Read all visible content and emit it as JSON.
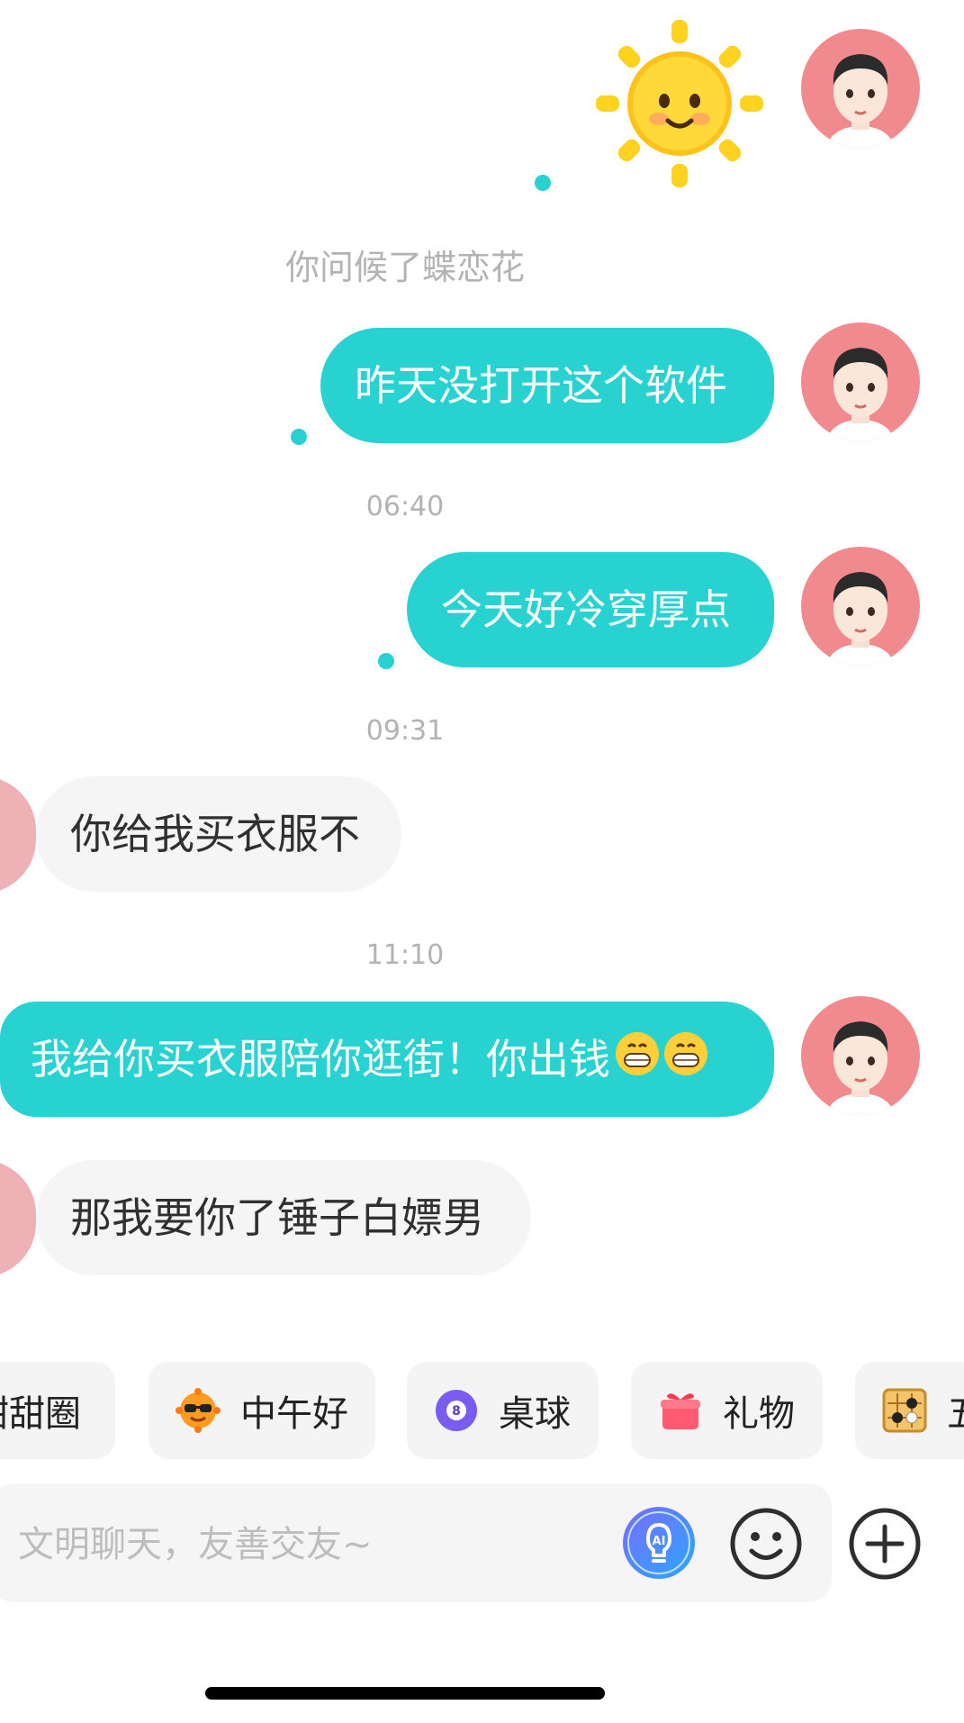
{
  "system_note": "你问候了蝶恋花",
  "messages": [
    {
      "side": "me",
      "text": "昨天没打开这个软件"
    },
    {
      "time": "06:40"
    },
    {
      "side": "me",
      "text": "今天好冷穿厚点"
    },
    {
      "time": "09:31"
    },
    {
      "side": "other",
      "text": "你给我买衣服不"
    },
    {
      "time": "11:10"
    },
    {
      "side": "me",
      "text": "我给你买衣服陪你逛街！你出钱",
      "trailing_emoji": "grinning-face ×2"
    },
    {
      "side": "other",
      "text": "那我要你了锤子白嫖男"
    }
  ],
  "quick_chips": [
    {
      "label": "甜甜圈",
      "icon": "donut-icon"
    },
    {
      "label": "中午好",
      "icon": "sunglasses-sun-icon"
    },
    {
      "label": "桌球",
      "icon": "billiard-ball-icon"
    },
    {
      "label": "礼物",
      "icon": "gift-icon"
    },
    {
      "label": "五",
      "icon": "go-board-icon"
    }
  ],
  "input": {
    "placeholder": "文明聊天，友善交友~"
  },
  "colors": {
    "accent": "#27d2d0",
    "bubble_other": "#f5f5f5",
    "avatar_bg": "#f08a8f"
  }
}
